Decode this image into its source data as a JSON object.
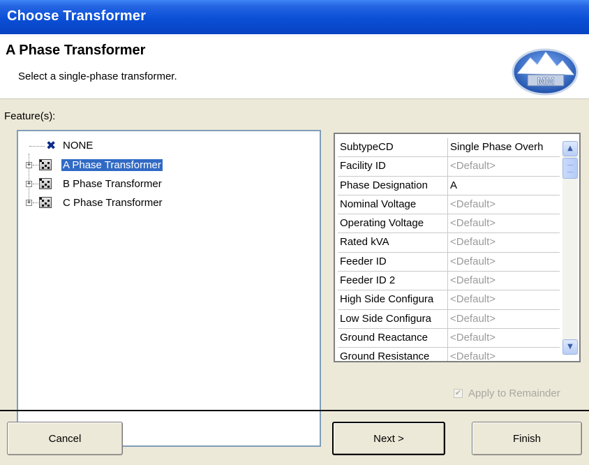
{
  "window": {
    "title": "Choose Transformer"
  },
  "header": {
    "title": "A Phase Transformer",
    "subtitle": "Select a single-phase transformer.",
    "logo_text": "MM"
  },
  "features": {
    "label": "Feature(s):",
    "items": [
      {
        "label": "NONE",
        "icon": "x-icon",
        "expandable": false
      },
      {
        "label": "A Phase Transformer",
        "icon": "transformer-icon",
        "expandable": true,
        "selected": true
      },
      {
        "label": "B Phase Transformer",
        "icon": "transformer-icon",
        "expandable": true
      },
      {
        "label": "C Phase Transformer",
        "icon": "transformer-icon",
        "expandable": true
      }
    ]
  },
  "attributes": {
    "rows": [
      {
        "key": "SubtypeCD",
        "value": "Single Phase Overh",
        "is_default": false
      },
      {
        "key": "Facility ID",
        "value": "<Default>",
        "is_default": true
      },
      {
        "key": "Phase Designation",
        "value": "A",
        "is_default": false
      },
      {
        "key": "Nominal Voltage",
        "value": "<Default>",
        "is_default": true
      },
      {
        "key": "Operating Voltage",
        "value": "<Default>",
        "is_default": true
      },
      {
        "key": "Rated kVA",
        "value": "<Default>",
        "is_default": true
      },
      {
        "key": "Feeder ID",
        "value": "<Default>",
        "is_default": true
      },
      {
        "key": "Feeder ID 2",
        "value": "<Default>",
        "is_default": true
      },
      {
        "key": "High Side Configura",
        "value": "<Default>",
        "is_default": true
      },
      {
        "key": "Low Side Configura",
        "value": "<Default>",
        "is_default": true
      },
      {
        "key": "Ground Reactance",
        "value": "<Default>",
        "is_default": true
      },
      {
        "key": "Ground Resistance",
        "value": "<Default>",
        "is_default": true
      }
    ]
  },
  "apply_remainder": {
    "label": "Apply to Remainder",
    "checked": true,
    "disabled": true
  },
  "buttons": {
    "cancel": "Cancel",
    "next": "Next >",
    "finish": "Finish"
  },
  "colors": {
    "titlebar": "#0a4fd6",
    "selection": "#316ac5",
    "window_bg": "#ece9d8"
  }
}
